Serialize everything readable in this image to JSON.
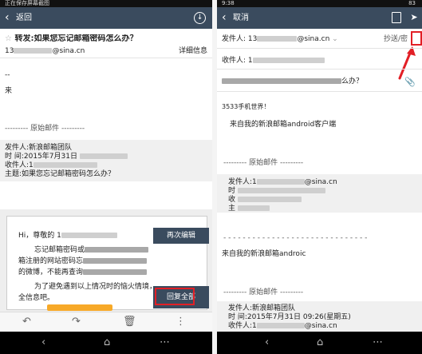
{
  "left": {
    "statusbar": "正在保存屏幕截图",
    "appbar": {
      "back_label": "返回"
    },
    "subject": "转发:如果您忘记邮箱密码怎么办？",
    "sender_prefix": "13",
    "sender_suffix": "@sina.cn",
    "detail_link": "详细信息",
    "dash": "--",
    "partial_char": "来",
    "orig_sep": "--------- 原始邮件 ---------",
    "orig": {
      "from_label": "发件人:新浪邮箱团队",
      "time_label": "时 间:2015年7月31日",
      "to_label": "收件人:1",
      "subject_label": "主题:如果您忘记邮箱密码怎么办？"
    },
    "card": {
      "greeting": "Hi，尊敬的 1",
      "line1": "忘记邮箱密码或",
      "line2": "箱注册的网站密码忘",
      "line3": "的微博，不能再查询",
      "line4": "为了避免遇到以上情况时的恼火情境，",
      "line5": "全信息吧。"
    },
    "reedit_button": "再次编辑",
    "reply_all_button": "回复全部",
    "toolbar": [
      "reply-icon",
      "forward-icon",
      "trash-icon",
      "more-icon"
    ],
    "navbar": [
      "back-icon",
      "home-icon",
      "menu-icon"
    ]
  },
  "right": {
    "statusbar_time": "9:38",
    "statusbar_right": "83",
    "appbar": {
      "cancel_label": "取消"
    },
    "from_label": "发件人: 13",
    "from_suffix": "@sina.cn",
    "cc_link": "抄送/密",
    "to_label": "收件人: 1",
    "subject_tail": "么办？",
    "body1": "3533手机世界！",
    "signature1": "来自我的新浪邮箱android客户端",
    "orig_sep1": "--------- 原始邮件 ---------",
    "quote1_prefix": "发件人:1",
    "quote1_suffix": "@sina.cn",
    "quote_line_chars": [
      "时",
      "收",
      "主"
    ],
    "signature2": "来自我的新浪邮箱androic",
    "orig_sep2": "--------- 原始邮件 ---------",
    "quote2": {
      "from_label": "发件人:新浪邮箱团队",
      "time_label": "时 间:2015年7月31日 09:26(星期五)",
      "to_label": "收件人:1",
      "to_suffix": "@sina.cn"
    },
    "navbar": [
      "back-icon",
      "home-icon",
      "menu-icon"
    ]
  },
  "colors": {
    "appbar": "#3a4b5e",
    "highlight": "#e21f26",
    "accent_orange": "#f7a928"
  }
}
